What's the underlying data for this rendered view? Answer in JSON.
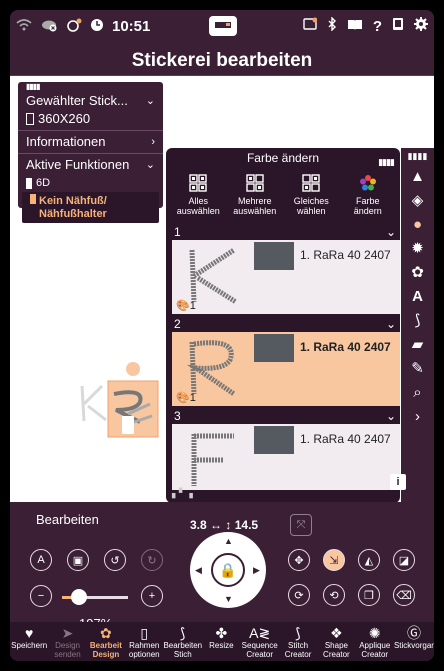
{
  "status": {
    "time": "10:51"
  },
  "title": "Stickerei bearbeiten",
  "left_panel": {
    "selected_label": "Gewählter Stick...",
    "hoop": "360X260",
    "info": "Informationen",
    "active": "Aktive Funktionen",
    "feature": "6D",
    "foot_line1": "Kein Nähfuß/",
    "foot_line2": "Nähfußhalter"
  },
  "color_panel": {
    "title": "Farbe ändern",
    "tools": [
      {
        "line1": "Alles",
        "line2": "auswählen"
      },
      {
        "line1": "Mehrere",
        "line2": "auswählen"
      },
      {
        "line1": "Gleiches",
        "line2": "wählen"
      },
      {
        "line1": "Farbe",
        "line2": "ändern"
      }
    ],
    "items": [
      {
        "num": "1",
        "thread": "1. RaRa 40  2407",
        "count": "1"
      },
      {
        "num": "2",
        "thread": "1. RaRa 40  2407",
        "count": "1"
      },
      {
        "num": "3",
        "thread": "1. RaRa 40  2407",
        "count": ""
      }
    ],
    "accent": "#f8c7a0"
  },
  "bottom": {
    "label": "Bearbeiten",
    "x_value": "3.8",
    "y_value": "14.5",
    "zoom": "197%",
    "zoom_fraction": 0.26
  },
  "tabs": [
    {
      "l1": "Speichern",
      "l2": ""
    },
    {
      "l1": "Design",
      "l2": "senden"
    },
    {
      "l1": "Bearbeit",
      "l2": "Design"
    },
    {
      "l1": "Rahmen",
      "l2": "optionen"
    },
    {
      "l1": "Bearbeiten",
      "l2": "Stich"
    },
    {
      "l1": "Resize",
      "l2": ""
    },
    {
      "l1": "Sequence",
      "l2": "Creator"
    },
    {
      "l1": "Stitch",
      "l2": "Creator"
    },
    {
      "l1": "Shape",
      "l2": "Creator"
    },
    {
      "l1": "Applique",
      "l2": "Creator"
    },
    {
      "l1": "Stickvorgar",
      "l2": ""
    }
  ]
}
